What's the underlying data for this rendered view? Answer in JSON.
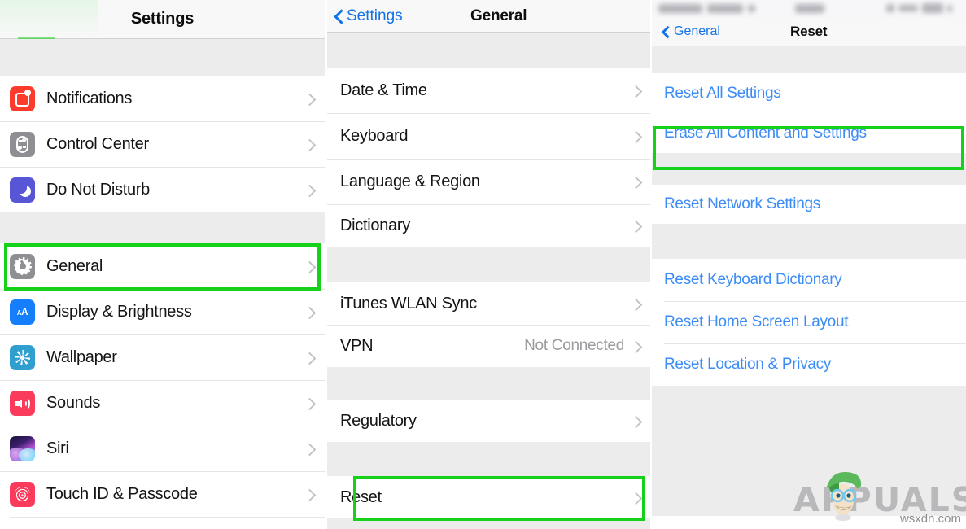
{
  "panels": {
    "settings": {
      "nav": {
        "title": "Settings"
      },
      "groups": [
        {
          "rows": [
            {
              "label": "Notifications",
              "icon": "notifications-icon",
              "chevron": true
            },
            {
              "label": "Control Center",
              "icon": "control-center-icon",
              "chevron": true
            },
            {
              "label": "Do Not Disturb",
              "icon": "do-not-disturb-icon",
              "chevron": true
            }
          ]
        },
        {
          "rows": [
            {
              "label": "General",
              "icon": "general-gear-icon",
              "chevron": true,
              "highlight": true
            },
            {
              "label": "Display & Brightness",
              "icon": "display-brightness-icon",
              "chevron": true
            },
            {
              "label": "Wallpaper",
              "icon": "wallpaper-icon",
              "chevron": true
            },
            {
              "label": "Sounds",
              "icon": "sounds-icon",
              "chevron": true
            },
            {
              "label": "Siri",
              "icon": "siri-icon",
              "chevron": true
            },
            {
              "label": "Touch ID & Passcode",
              "icon": "touch-id-passcode-icon",
              "chevron": true
            }
          ]
        }
      ]
    },
    "general": {
      "nav": {
        "back_label": "Settings",
        "title": "General"
      },
      "groups": [
        {
          "rows": [
            {
              "label": "Date & Time",
              "chevron": true
            },
            {
              "label": "Keyboard",
              "chevron": true
            },
            {
              "label": "Language & Region",
              "chevron": true
            },
            {
              "label": "Dictionary",
              "chevron": true
            }
          ]
        },
        {
          "rows": [
            {
              "label": "iTunes WLAN Sync",
              "chevron": true
            },
            {
              "label": "VPN",
              "value": "Not Connected",
              "chevron": true
            }
          ]
        },
        {
          "rows": [
            {
              "label": "Regulatory",
              "chevron": true
            }
          ]
        },
        {
          "rows": [
            {
              "label": "Reset",
              "chevron": true,
              "highlight": true
            }
          ]
        }
      ]
    },
    "reset": {
      "nav": {
        "back_label": "General",
        "title": "Reset"
      },
      "groups": [
        {
          "rows": [
            {
              "label": "Reset All Settings",
              "link": true
            },
            {
              "label": "Erase All Content and Settings",
              "link": true,
              "highlight": true
            }
          ]
        },
        {
          "rows": [
            {
              "label": "Reset Network Settings",
              "link": true
            }
          ]
        },
        {
          "rows": [
            {
              "label": "Reset Keyboard Dictionary",
              "link": true
            },
            {
              "label": "Reset Home Screen Layout",
              "link": true
            },
            {
              "label": "Reset Location & Privacy",
              "link": true
            }
          ]
        }
      ]
    }
  },
  "watermark": {
    "brand": "APPUALS",
    "site": "wsxdn.com"
  },
  "colors": {
    "link_blue": "#3b8cf7",
    "back_blue": "#1273e6",
    "highlight_green": "#16d11a",
    "group_gap": "#ececed",
    "separator": "#e6e6e6"
  }
}
